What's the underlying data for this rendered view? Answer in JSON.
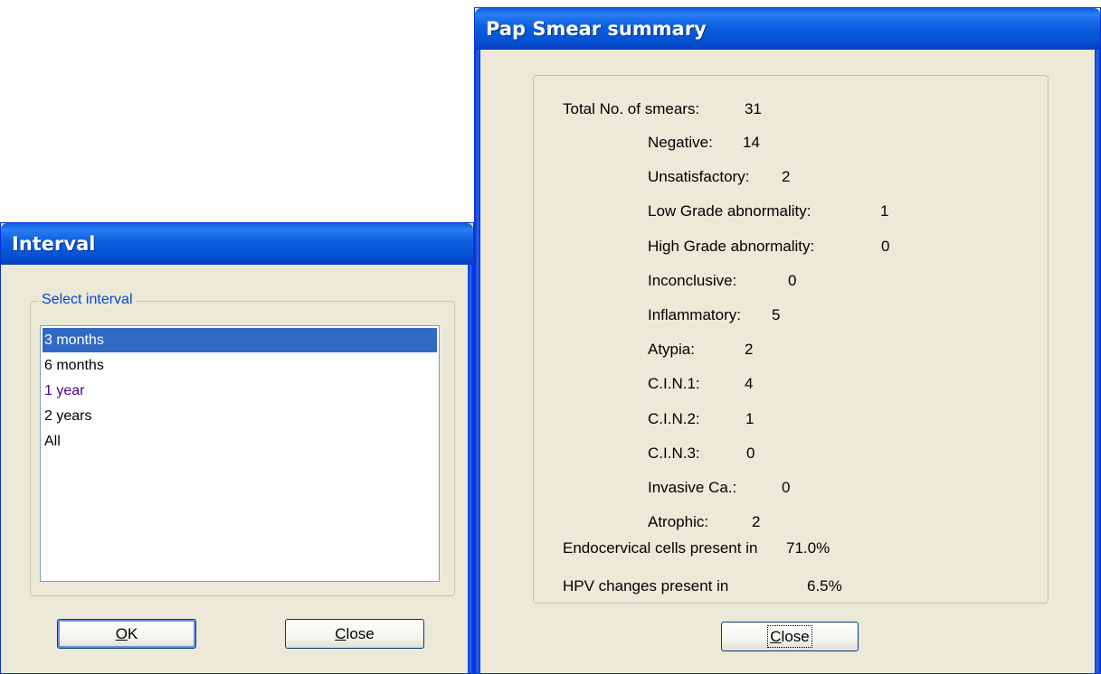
{
  "interval_dialog": {
    "title": "Interval",
    "group_label": "Select interval",
    "options": [
      "3 months",
      "6 months",
      "1 year",
      "2 years",
      "All"
    ],
    "selected_index": 0,
    "ok_label": "OK",
    "close_label": "Close"
  },
  "summary_dialog": {
    "title": "Pap Smear summary",
    "total_label": "Total No. of smears:",
    "total_value": "31",
    "categories": [
      {
        "label": "Negative:",
        "value": "14"
      },
      {
        "label": "Unsatisfactory:",
        "value": "2"
      },
      {
        "label": "Low Grade abnormality:",
        "value": "1"
      },
      {
        "label": "High Grade abnormality:",
        "value": "0"
      },
      {
        "label": "Inconclusive:",
        "value": "0"
      },
      {
        "label": "Inflammatory:",
        "value": "5"
      },
      {
        "label": "Atypia:",
        "value": "2"
      },
      {
        "label": "C.I.N.1:",
        "value": "4"
      },
      {
        "label": "C.I.N.2:",
        "value": "1"
      },
      {
        "label": "C.I.N.3:",
        "value": "0"
      },
      {
        "label": "Invasive Ca.:",
        "value": "0"
      },
      {
        "label": "Atrophic:",
        "value": "2"
      }
    ],
    "endocervical_label": "Endocervical cells present in",
    "endocervical_value": "71.0%",
    "hpv_label": "HPV changes present in",
    "hpv_value": "6.5%",
    "close_label": "Close"
  }
}
